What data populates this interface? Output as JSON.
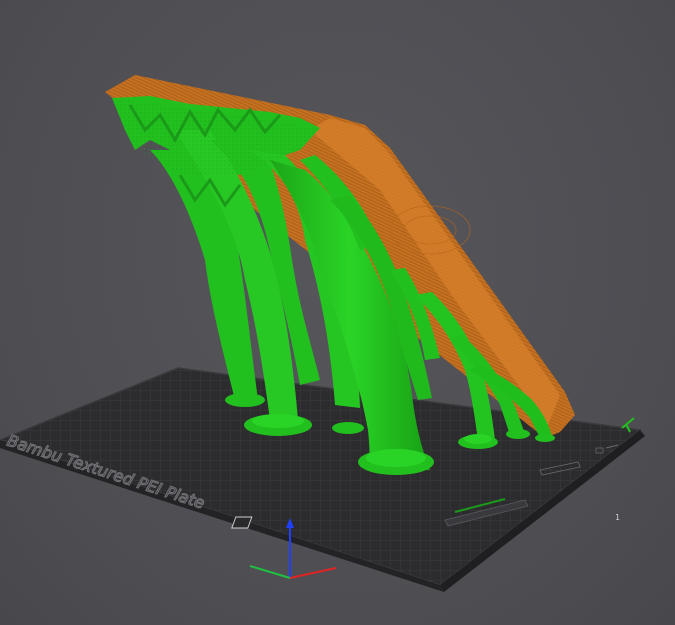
{
  "viewport": {
    "plate_label": "Bambu Textured PEI Plate",
    "plate_number": "1",
    "colors": {
      "background": "#505055",
      "plate": "#2c2c2f",
      "grid": "#48484c",
      "support": "#22c01e",
      "model": "#c77220",
      "axis_x": "#e02424",
      "axis_y": "#20c040",
      "axis_z": "#2040ff"
    }
  }
}
